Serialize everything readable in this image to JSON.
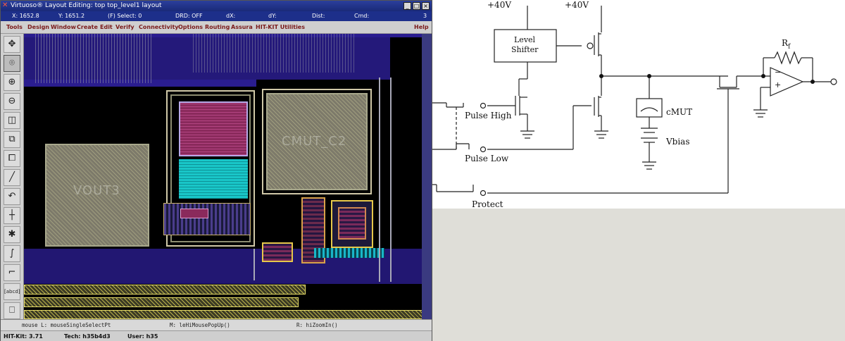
{
  "window": {
    "title": "Virtuoso® Layout Editing: top top_level1 layout",
    "minimize_glyph": "_",
    "maximize_glyph": "□",
    "close_glyph": "×"
  },
  "status": {
    "x": "X: 1652.8",
    "y": "Y: 1651.2",
    "select": "(F) Select: 0",
    "drd": "DRD: OFF",
    "dx": "dX:",
    "dy": "dY:",
    "dist": "Dist:",
    "cmd": "Cmd:",
    "count": "3"
  },
  "menu": {
    "items": [
      "Tools",
      "Design",
      "Window",
      "Create",
      "Edit",
      "Verify",
      "Connectivity",
      "Options",
      "Routing",
      "Assura",
      "HIT-KIT Utilities"
    ],
    "help": "Help"
  },
  "toolbar": {
    "icons": [
      "pan-icon",
      "zoom-fit-icon",
      "zoom-in-icon",
      "zoom-out-icon",
      "stretch-icon",
      "copy-icon",
      "move-icon",
      "path-icon",
      "undo-icon",
      "ruler-icon",
      "hierarchy-icon",
      "wire-icon",
      "corner-icon",
      "label-icon",
      "property-icon",
      "erase-icon"
    ],
    "glyphs": [
      "✥",
      "⌾",
      "⊕",
      "⊖",
      "◫",
      "⧉",
      "⧠",
      "╱",
      "↶",
      "┼",
      "✱",
      "∫",
      "⌐",
      "[abcd]",
      "⎕",
      "╱"
    ]
  },
  "canvas": {
    "pad_left": "VOUT3",
    "pad_right": "CMUT_C2"
  },
  "mouse": {
    "left": "mouse L: mouseSingleSelectPt",
    "middle": "M: leHiMousePopUp()",
    "right": "R: hiZoomIn()"
  },
  "kit": {
    "version": "HIT-Kit: 3.71",
    "tech": "Tech: h35b4d3",
    "user": "User: h35"
  },
  "schematic": {
    "supply_left": "+40V",
    "supply_right": "+40V",
    "level_shifter_line1": "Level",
    "level_shifter_line2": "Shifter",
    "pulse_high": "Pulse High",
    "pulse_low": "Pulse Low",
    "protect": "Protect",
    "cmut": "cMUT",
    "vbias": "Vbias",
    "rf": "R",
    "rf_sub": "f",
    "opamp_minus": "−",
    "opamp_plus": "+"
  }
}
